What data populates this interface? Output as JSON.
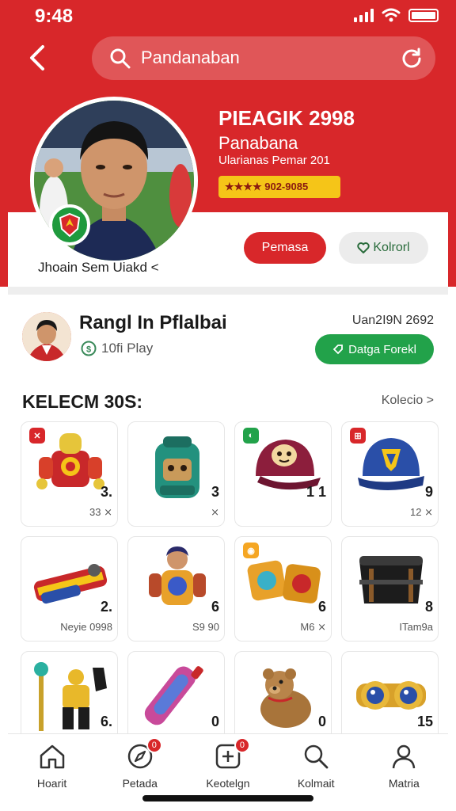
{
  "status": {
    "time": "9:48"
  },
  "header": {
    "search_value": "Pandanaban",
    "title": "PIEAGIK 2998",
    "subtitle": "Panabana",
    "meta": "Ularianas Pemar 201",
    "rating": "★★★★ 902-9085",
    "user_caption": "Jhoain Sem Uiakd <",
    "primary_btn": "Pemasa",
    "secondary_btn": "Kolrorl"
  },
  "seller": {
    "name": "Rangl In Pflalbai",
    "meta": "10fi Play",
    "date": "Uan2I9N 2692",
    "action": "Datga Forekl"
  },
  "collection": {
    "title": "KELECM 30S:",
    "link": "Kolecio >",
    "items": [
      {
        "icon": "red-robot-suit",
        "tag": "✕",
        "tag_color": "#d8272a",
        "count": "3.",
        "price": "33 ⨯"
      },
      {
        "icon": "green-backpack",
        "tag": "",
        "tag_color": "",
        "count": "3",
        "price": "⨯"
      },
      {
        "icon": "maroon-cap",
        "tag": "◐",
        "tag_color": "#22a24a",
        "count": "1 1",
        "price": ""
      },
      {
        "icon": "blue-cap",
        "tag": "⊞",
        "tag_color": "#d8272a",
        "count": "9",
        "price": "12 ⨯"
      },
      {
        "icon": "red-rocket-launcher",
        "tag": "",
        "tag_color": "",
        "count": "2.",
        "price": "Neyie 0998"
      },
      {
        "icon": "character-figure",
        "tag": "",
        "tag_color": "",
        "count": "6",
        "price": "S9 90"
      },
      {
        "icon": "gold-shields",
        "tag": "◉",
        "tag_color": "#f5a623",
        "count": "6",
        "price": "M6 ⨯"
      },
      {
        "icon": "black-bag",
        "tag": "",
        "tag_color": "",
        "count": "8",
        "price": "ITam9a"
      },
      {
        "icon": "staff-and-suit",
        "tag": "",
        "tag_color": "",
        "count": "6.",
        "price": ""
      },
      {
        "icon": "color-bottle",
        "tag": "",
        "tag_color": "",
        "count": "0",
        "price": ""
      },
      {
        "icon": "bear-plush",
        "tag": "",
        "tag_color": "",
        "count": "0",
        "price": ""
      },
      {
        "icon": "gold-goggles",
        "tag": "",
        "tag_color": "",
        "count": "15",
        "price": ""
      }
    ]
  },
  "nav": [
    {
      "label": "Hoarit",
      "icon": "home-icon",
      "badge": ""
    },
    {
      "label": "Petada",
      "icon": "compass-icon",
      "badge": "0"
    },
    {
      "label": "Keotelgn",
      "icon": "add-square-icon",
      "badge": "0"
    },
    {
      "label": "Kolmait",
      "icon": "search-icon",
      "badge": ""
    },
    {
      "label": "Matria",
      "icon": "profile-icon",
      "badge": ""
    }
  ],
  "colors": {
    "brand_red": "#d8272a",
    "action_green": "#22a24a",
    "rating_yellow": "#f5c518"
  }
}
